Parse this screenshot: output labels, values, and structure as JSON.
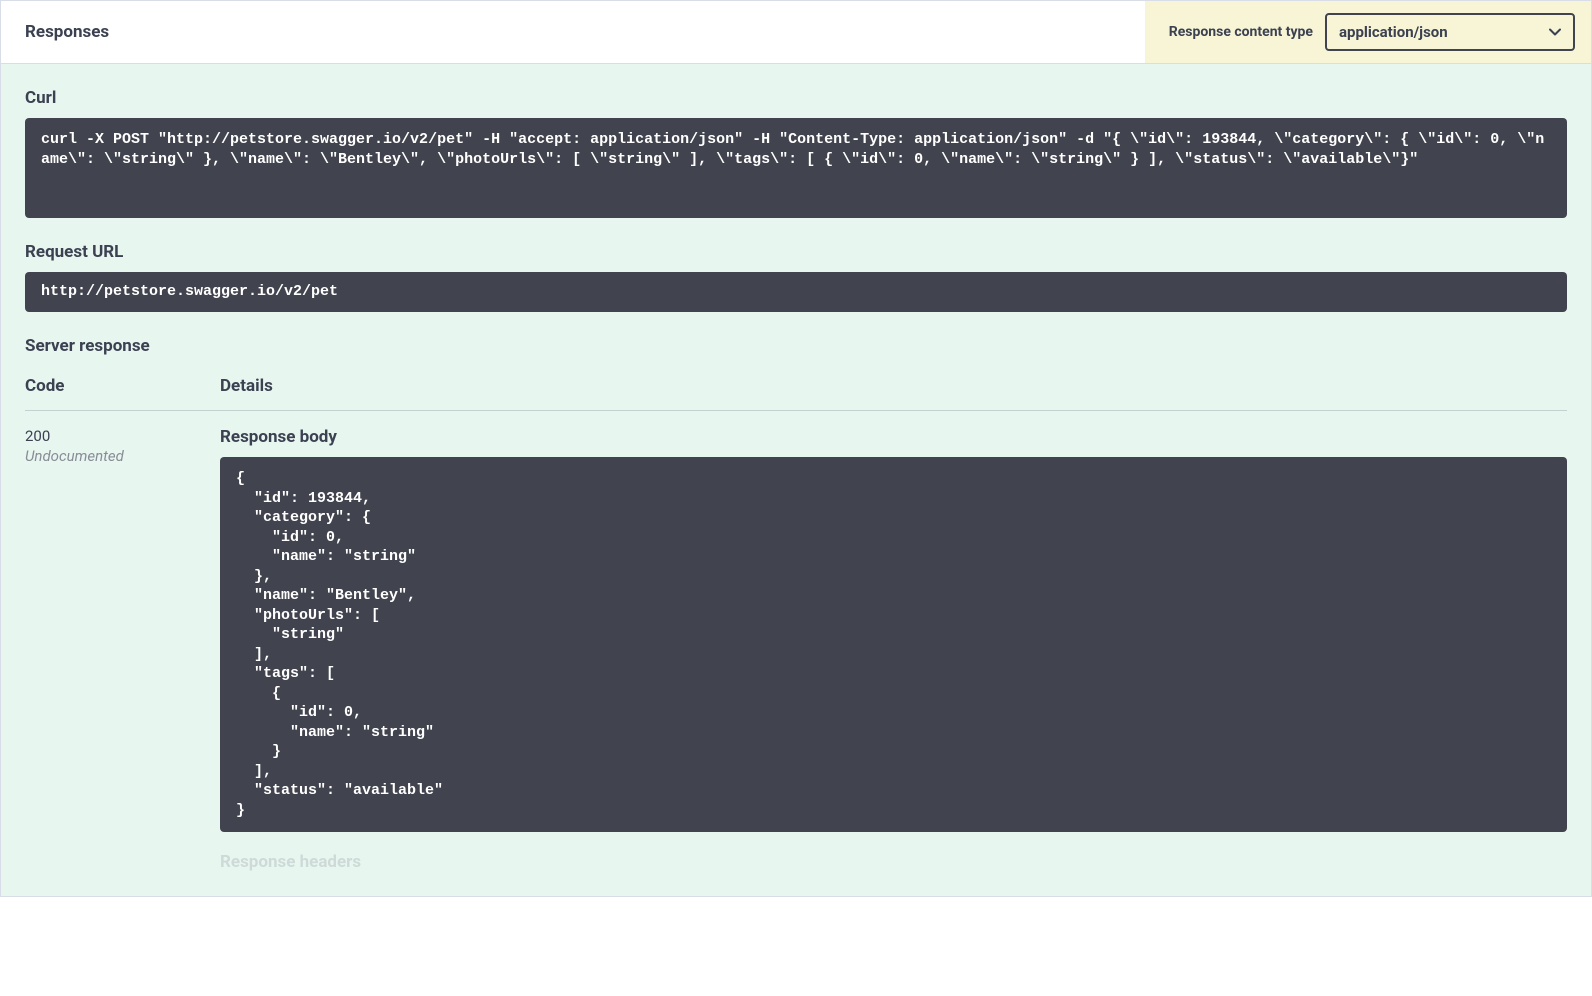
{
  "header": {
    "title": "Responses",
    "content_type_label": "Response content type",
    "content_type_value": "application/json"
  },
  "curl": {
    "label": "Curl",
    "command": "curl -X POST \"http://petstore.swagger.io/v2/pet\" -H \"accept: application/json\" -H \"Content-Type: application/json\" -d \"{ \\\"id\\\": 193844, \\\"category\\\": { \\\"id\\\": 0, \\\"name\\\": \\\"string\\\" }, \\\"name\\\": \\\"Bentley\\\", \\\"photoUrls\\\": [ \\\"string\\\" ], \\\"tags\\\": [ { \\\"id\\\": 0, \\\"name\\\": \\\"string\\\" } ], \\\"status\\\": \\\"available\\\"}\""
  },
  "request_url": {
    "label": "Request URL",
    "value": "http://petstore.swagger.io/v2/pet"
  },
  "server_response": {
    "label": "Server response",
    "code_header": "Code",
    "details_header": "Details",
    "code": "200",
    "undocumented": "Undocumented",
    "body_label": "Response body",
    "body": "{\n  \"id\": 193844,\n  \"category\": {\n    \"id\": 0,\n    \"name\": \"string\"\n  },\n  \"name\": \"Bentley\",\n  \"photoUrls\": [\n    \"string\"\n  ],\n  \"tags\": [\n    {\n      \"id\": 0,\n      \"name\": \"string\"\n    }\n  ],\n  \"status\": \"available\"\n}",
    "headers_label": "Response headers"
  }
}
